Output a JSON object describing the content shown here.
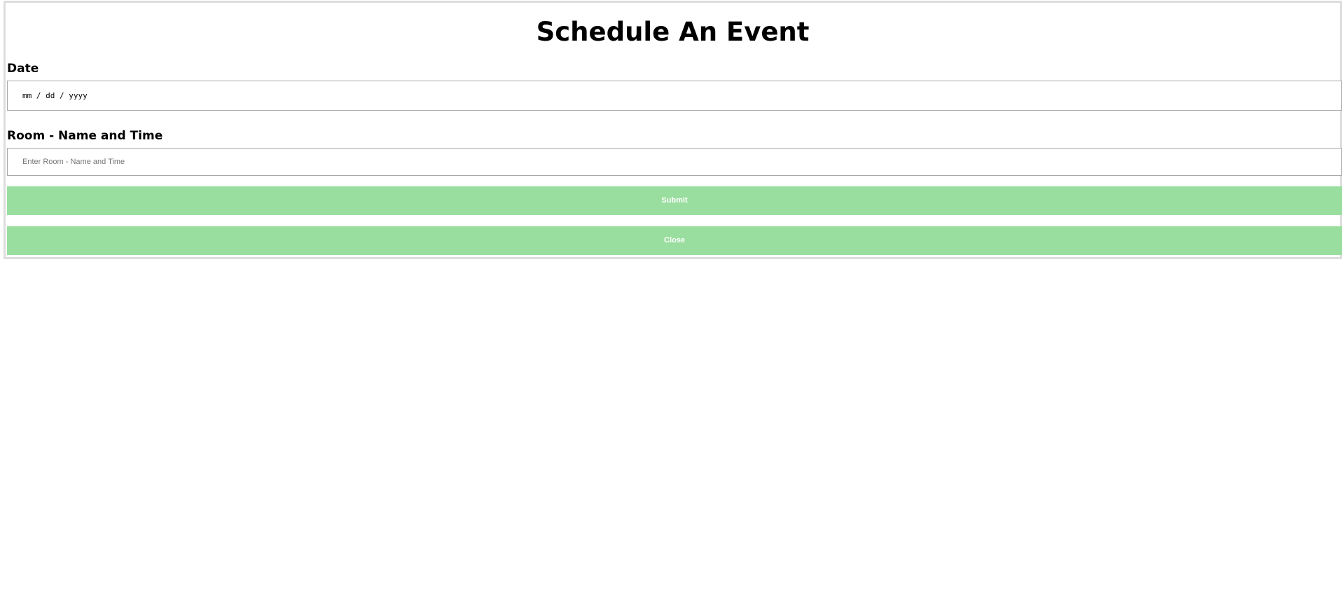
{
  "modal": {
    "title": "Schedule An Event",
    "date": {
      "label": "Date",
      "placeholder": "mm / dd / yyyy",
      "value": ""
    },
    "room": {
      "label": "Room - Name and Time",
      "placeholder": "Enter Room - Name and Time",
      "value": ""
    },
    "buttons": {
      "submit_label": "Submit",
      "close_label": "Close"
    }
  },
  "colors": {
    "button_background": "#9ade9f",
    "button_text": "#ffffff",
    "input_border": "#a9a9a9",
    "modal_border": "#dddddd"
  }
}
